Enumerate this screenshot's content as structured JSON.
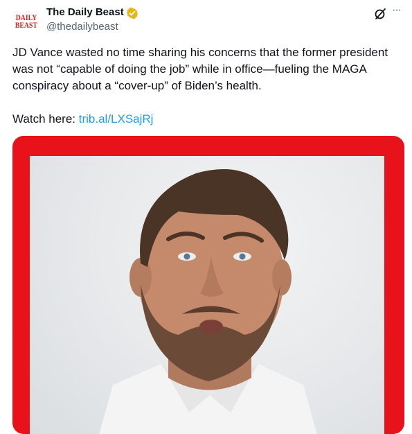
{
  "author": {
    "avatar_line1": "DAILY",
    "avatar_line2": "BEAST",
    "display_name": "The Daily Beast",
    "handle": "@thedailybeast",
    "verified_color": "#e2b719"
  },
  "tweet": {
    "text": "JD Vance wasted no time sharing his concerns that the former president was not “capable of doing the job” while in office—fueling the MAGA conspiracy about a “cover-up” of Biden’s health.",
    "watch_prefix": "Watch here: ",
    "link_text": "trib.al/LXSajRj"
  },
  "actions": {
    "grok_icon": "grok-icon",
    "more_icon": "more-icon"
  },
  "media": {
    "frame_color": "#e8131a",
    "description_icon": "photo"
  },
  "colors": {
    "link": "#1d9bf0",
    "secondary_text": "#536471"
  }
}
